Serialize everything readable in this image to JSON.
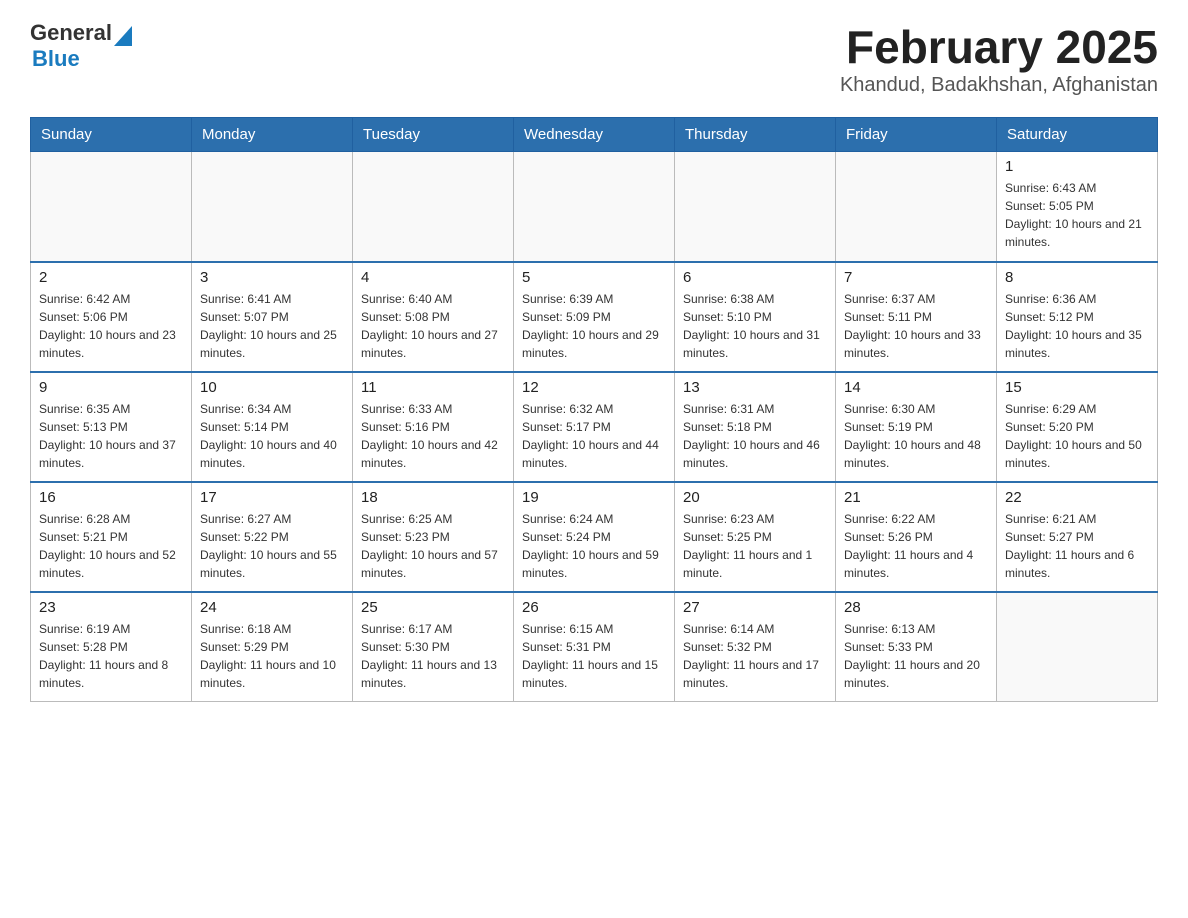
{
  "header": {
    "logo_general": "General",
    "logo_blue": "Blue",
    "month_title": "February 2025",
    "location": "Khandud, Badakhshan, Afghanistan"
  },
  "days_of_week": [
    "Sunday",
    "Monday",
    "Tuesday",
    "Wednesday",
    "Thursday",
    "Friday",
    "Saturday"
  ],
  "weeks": [
    [
      {
        "day": "",
        "info": ""
      },
      {
        "day": "",
        "info": ""
      },
      {
        "day": "",
        "info": ""
      },
      {
        "day": "",
        "info": ""
      },
      {
        "day": "",
        "info": ""
      },
      {
        "day": "",
        "info": ""
      },
      {
        "day": "1",
        "info": "Sunrise: 6:43 AM\nSunset: 5:05 PM\nDaylight: 10 hours and 21 minutes."
      }
    ],
    [
      {
        "day": "2",
        "info": "Sunrise: 6:42 AM\nSunset: 5:06 PM\nDaylight: 10 hours and 23 minutes."
      },
      {
        "day": "3",
        "info": "Sunrise: 6:41 AM\nSunset: 5:07 PM\nDaylight: 10 hours and 25 minutes."
      },
      {
        "day": "4",
        "info": "Sunrise: 6:40 AM\nSunset: 5:08 PM\nDaylight: 10 hours and 27 minutes."
      },
      {
        "day": "5",
        "info": "Sunrise: 6:39 AM\nSunset: 5:09 PM\nDaylight: 10 hours and 29 minutes."
      },
      {
        "day": "6",
        "info": "Sunrise: 6:38 AM\nSunset: 5:10 PM\nDaylight: 10 hours and 31 minutes."
      },
      {
        "day": "7",
        "info": "Sunrise: 6:37 AM\nSunset: 5:11 PM\nDaylight: 10 hours and 33 minutes."
      },
      {
        "day": "8",
        "info": "Sunrise: 6:36 AM\nSunset: 5:12 PM\nDaylight: 10 hours and 35 minutes."
      }
    ],
    [
      {
        "day": "9",
        "info": "Sunrise: 6:35 AM\nSunset: 5:13 PM\nDaylight: 10 hours and 37 minutes."
      },
      {
        "day": "10",
        "info": "Sunrise: 6:34 AM\nSunset: 5:14 PM\nDaylight: 10 hours and 40 minutes."
      },
      {
        "day": "11",
        "info": "Sunrise: 6:33 AM\nSunset: 5:16 PM\nDaylight: 10 hours and 42 minutes."
      },
      {
        "day": "12",
        "info": "Sunrise: 6:32 AM\nSunset: 5:17 PM\nDaylight: 10 hours and 44 minutes."
      },
      {
        "day": "13",
        "info": "Sunrise: 6:31 AM\nSunset: 5:18 PM\nDaylight: 10 hours and 46 minutes."
      },
      {
        "day": "14",
        "info": "Sunrise: 6:30 AM\nSunset: 5:19 PM\nDaylight: 10 hours and 48 minutes."
      },
      {
        "day": "15",
        "info": "Sunrise: 6:29 AM\nSunset: 5:20 PM\nDaylight: 10 hours and 50 minutes."
      }
    ],
    [
      {
        "day": "16",
        "info": "Sunrise: 6:28 AM\nSunset: 5:21 PM\nDaylight: 10 hours and 52 minutes."
      },
      {
        "day": "17",
        "info": "Sunrise: 6:27 AM\nSunset: 5:22 PM\nDaylight: 10 hours and 55 minutes."
      },
      {
        "day": "18",
        "info": "Sunrise: 6:25 AM\nSunset: 5:23 PM\nDaylight: 10 hours and 57 minutes."
      },
      {
        "day": "19",
        "info": "Sunrise: 6:24 AM\nSunset: 5:24 PM\nDaylight: 10 hours and 59 minutes."
      },
      {
        "day": "20",
        "info": "Sunrise: 6:23 AM\nSunset: 5:25 PM\nDaylight: 11 hours and 1 minute."
      },
      {
        "day": "21",
        "info": "Sunrise: 6:22 AM\nSunset: 5:26 PM\nDaylight: 11 hours and 4 minutes."
      },
      {
        "day": "22",
        "info": "Sunrise: 6:21 AM\nSunset: 5:27 PM\nDaylight: 11 hours and 6 minutes."
      }
    ],
    [
      {
        "day": "23",
        "info": "Sunrise: 6:19 AM\nSunset: 5:28 PM\nDaylight: 11 hours and 8 minutes."
      },
      {
        "day": "24",
        "info": "Sunrise: 6:18 AM\nSunset: 5:29 PM\nDaylight: 11 hours and 10 minutes."
      },
      {
        "day": "25",
        "info": "Sunrise: 6:17 AM\nSunset: 5:30 PM\nDaylight: 11 hours and 13 minutes."
      },
      {
        "day": "26",
        "info": "Sunrise: 6:15 AM\nSunset: 5:31 PM\nDaylight: 11 hours and 15 minutes."
      },
      {
        "day": "27",
        "info": "Sunrise: 6:14 AM\nSunset: 5:32 PM\nDaylight: 11 hours and 17 minutes."
      },
      {
        "day": "28",
        "info": "Sunrise: 6:13 AM\nSunset: 5:33 PM\nDaylight: 11 hours and 20 minutes."
      },
      {
        "day": "",
        "info": ""
      }
    ]
  ]
}
